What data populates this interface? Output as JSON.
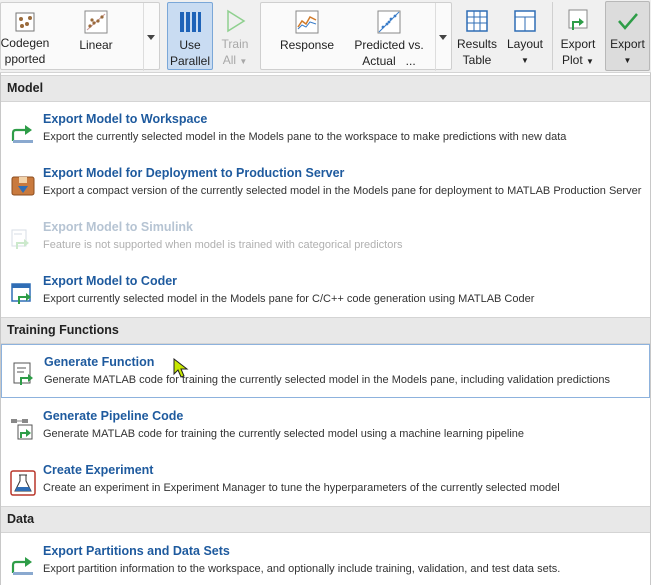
{
  "toolbar": {
    "codegen_line1": "Codegen",
    "codegen_line2": "pported",
    "linear": "Linear",
    "use_parallel_1": "Use",
    "use_parallel_2": "Parallel",
    "train_all_1": "Train",
    "train_all_2": "All",
    "response": "Response",
    "predicted_1": "Predicted vs.",
    "predicted_2": "Actual",
    "predicted_more": "...",
    "results_1": "Results",
    "results_2": "Table",
    "layout": "Layout",
    "export_plot_1": "Export",
    "export_plot_2": "Plot",
    "export": "Export"
  },
  "menu": {
    "sections": {
      "model": "Model",
      "training": "Training Functions",
      "data": "Data"
    },
    "items": [
      {
        "title": "Export Model to Workspace",
        "desc": "Export the currently selected model in the Models pane to the workspace to make predictions with new data"
      },
      {
        "title": "Export Model for Deployment to Production Server",
        "desc": "Export a compact version of the currently selected model in the Models pane for deployment to MATLAB Production Server"
      },
      {
        "title": "Export Model to Simulink",
        "desc": "Feature is not supported when model is trained with categorical predictors"
      },
      {
        "title": "Export Model to Coder",
        "desc": "Export currently selected model in the Models pane for C/C++ code generation using MATLAB Coder"
      },
      {
        "title": "Generate Function",
        "desc": "Generate MATLAB code for training the currently selected model in the Models pane, including validation predictions"
      },
      {
        "title": "Generate Pipeline Code",
        "desc": "Generate MATLAB code for training the currently selected model using a machine learning pipeline"
      },
      {
        "title": "Create Experiment",
        "desc": "Create an experiment in Experiment Manager to tune the hyperparameters of the currently selected model"
      },
      {
        "title": "Export Partitions and Data Sets",
        "desc": "Export partition information to the workspace, and optionally include training, validation, and test data sets."
      }
    ]
  },
  "colors": {
    "accent": "#1e5a9e",
    "active_fill": "#c9dcf2",
    "section_bg": "#e8e8e8"
  }
}
